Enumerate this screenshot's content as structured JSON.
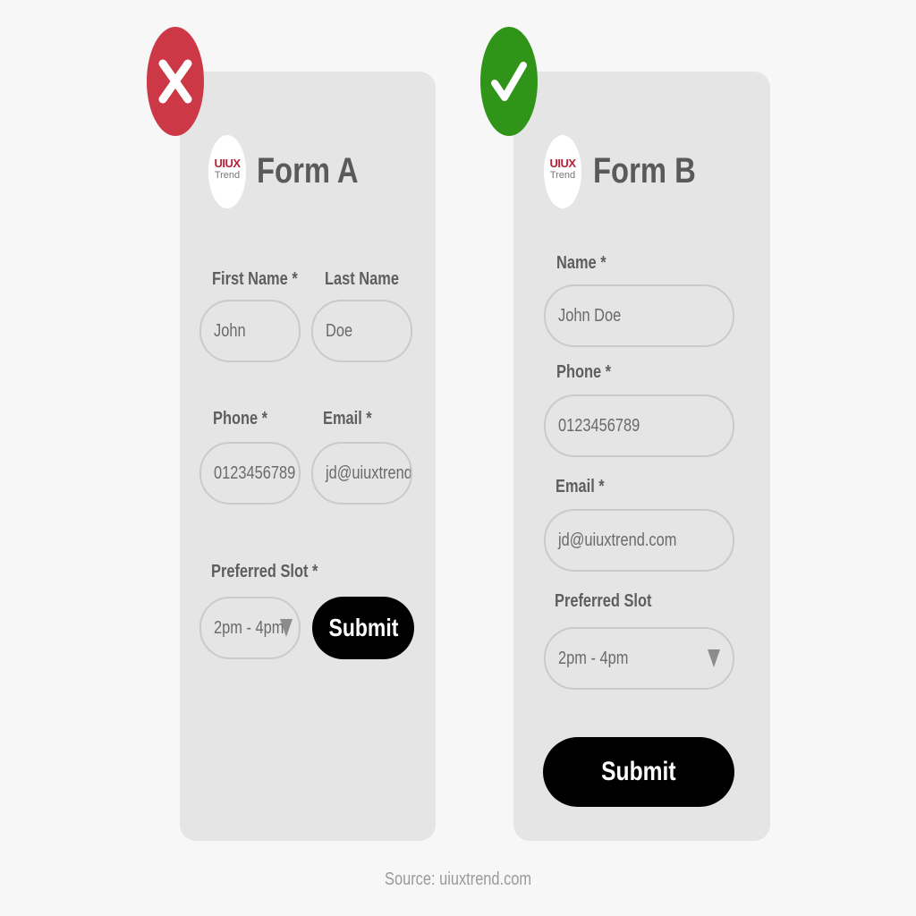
{
  "form_a": {
    "status_icon": "close-icon",
    "status_color": "#cc3845",
    "logo": {
      "line1": "UIUX",
      "line2": "Trend"
    },
    "title": "Form A",
    "first_name_label": "First Name *",
    "first_name_value": "John",
    "last_name_label": "Last Name",
    "last_name_value": "Doe",
    "phone_label": "Phone *",
    "phone_value": "0123456789",
    "email_label": "Email *",
    "email_value": "jd@uiuxtrend.",
    "slot_label": "Preferred Slot *",
    "slot_value": "2pm - 4pm",
    "submit_label": "Submit"
  },
  "form_b": {
    "status_icon": "check-icon",
    "status_color": "#2f9417",
    "logo": {
      "line1": "UIUX",
      "line2": "Trend"
    },
    "title": "Form B",
    "name_label": "Name *",
    "name_value": "John Doe",
    "phone_label": "Phone *",
    "phone_value": "0123456789",
    "email_label": "Email *",
    "email_value": "jd@uiuxtrend.com",
    "slot_label": "Preferred Slot",
    "slot_value": "2pm - 4pm",
    "submit_label": "Submit"
  },
  "source": "Source: uiuxtrend.com"
}
